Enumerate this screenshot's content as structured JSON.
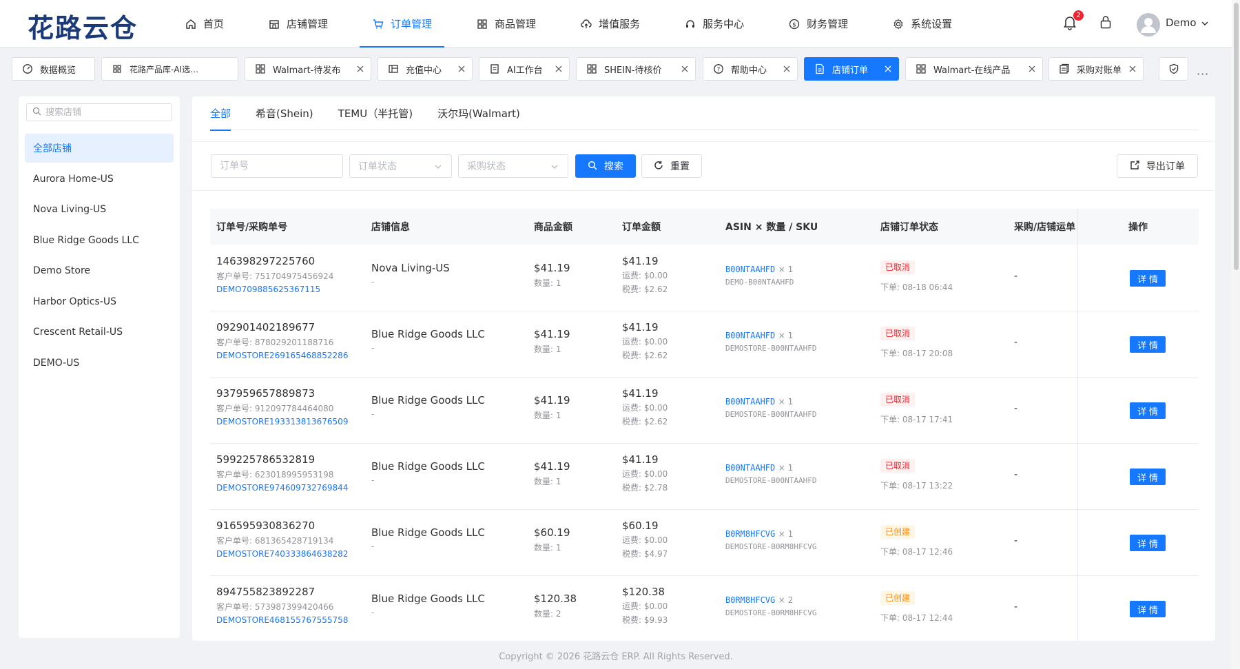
{
  "app": {
    "logo": "花路云仓"
  },
  "nav": [
    {
      "label": "首页",
      "icon": "home-icon"
    },
    {
      "label": "店铺管理",
      "icon": "store-icon"
    },
    {
      "label": "订单管理",
      "icon": "cart-icon",
      "active": true
    },
    {
      "label": "商品管理",
      "icon": "grid-icon"
    },
    {
      "label": "增值服务",
      "icon": "cloud-icon"
    },
    {
      "label": "服务中心",
      "icon": "headset-icon"
    },
    {
      "label": "财务管理",
      "icon": "dollar-icon"
    },
    {
      "label": "系统设置",
      "icon": "gear-icon"
    }
  ],
  "header": {
    "notification_count": "2",
    "username": "Demo"
  },
  "tabs": [
    {
      "label": "数据概览",
      "icon": "dashboard-icon",
      "closable": false
    },
    {
      "label": "花路产品库-AI选…",
      "icon": "grid-icon",
      "closable": false
    },
    {
      "label": "Walmart-待发布",
      "icon": "grid-icon",
      "closable": true
    },
    {
      "label": "充值中心",
      "icon": "wallet-icon",
      "closable": true
    },
    {
      "label": "AI工作台",
      "icon": "robot-icon",
      "closable": true
    },
    {
      "label": "SHEIN-待核价",
      "icon": "grid-icon",
      "closable": true
    },
    {
      "label": "帮助中心",
      "icon": "help-icon",
      "closable": true
    },
    {
      "label": "店铺订单",
      "icon": "document-icon",
      "closable": true,
      "active": true
    },
    {
      "label": "Walmart-在线产品",
      "icon": "grid-icon",
      "closable": true
    },
    {
      "label": "采购对账单",
      "icon": "ledger-icon",
      "closable": true
    },
    {
      "label": "",
      "icon": "shield-icon",
      "closable": false
    }
  ],
  "tab_more": "···",
  "stores": {
    "search_placeholder": "搜索店铺",
    "items": [
      "全部店铺",
      "Aurora Home-US",
      "Nova Living-US",
      "Blue Ridge Goods LLC",
      "Demo Store",
      "Harbor Optics-US",
      "Crescent Retail-US",
      "DEMO-US"
    ]
  },
  "platform_tabs": [
    "全部",
    "希音(Shein)",
    "TEMU（半托管)",
    "沃尔玛(Walmart)"
  ],
  "filters": {
    "order_no_placeholder": "订单号",
    "order_status_placeholder": "订单状态",
    "purchase_status_placeholder": "采购状态",
    "search_label": "搜索",
    "reset_label": "重置",
    "export_label": "导出订单"
  },
  "table": {
    "headers": [
      "订单号/采购单号",
      "店铺信息",
      "商品金额",
      "订单金额",
      "ASIN × 数量 / SKU",
      "店铺订单状态",
      "采购/店铺运单",
      "操作"
    ],
    "detail_label": "详情",
    "rows": [
      {
        "order_no": "146398297225760",
        "customer_no": "客户单号: 751704975456924",
        "po": "DEMO709885625367115",
        "store": "Nova Living-US",
        "store_sub": "-",
        "goods_amount": "$41.19",
        "qty": "数量: 1",
        "order_amount": "$41.19",
        "freight": "运费: $0.00",
        "tax": "税费: $2.62",
        "asin": "B00NTAAHFD",
        "asin_qty": "× 1",
        "sku": "DEMO-B00NTAAHFD",
        "status": "已取消",
        "status_type": "cancel",
        "order_time": "下单: 08-18 06:44",
        "ship": "-"
      },
      {
        "order_no": "092901402189677",
        "customer_no": "客户单号: 878029201188716",
        "po": "DEMOSTORE269165468852286",
        "store": "Blue Ridge Goods LLC",
        "store_sub": "-",
        "goods_amount": "$41.19",
        "qty": "数量: 1",
        "order_amount": "$41.19",
        "freight": "运费: $0.00",
        "tax": "税费: $2.62",
        "asin": "B00NTAAHFD",
        "asin_qty": "× 1",
        "sku": "DEMOSTORE-B00NTAAHFD",
        "status": "已取消",
        "status_type": "cancel",
        "order_time": "下单: 08-17 20:08",
        "ship": "-"
      },
      {
        "order_no": "937959657889873",
        "customer_no": "客户单号: 912097784464080",
        "po": "DEMOSTORE193313813676509",
        "store": "Blue Ridge Goods LLC",
        "store_sub": "-",
        "goods_amount": "$41.19",
        "qty": "数量: 1",
        "order_amount": "$41.19",
        "freight": "运费: $0.00",
        "tax": "税费: $2.62",
        "asin": "B00NTAAHFD",
        "asin_qty": "× 1",
        "sku": "DEMOSTORE-B00NTAAHFD",
        "status": "已取消",
        "status_type": "cancel",
        "order_time": "下单: 08-17 17:41",
        "ship": "-"
      },
      {
        "order_no": "599225786532819",
        "customer_no": "客户单号: 623018995953198",
        "po": "DEMOSTORE974609732769844",
        "store": "Blue Ridge Goods LLC",
        "store_sub": "-",
        "goods_amount": "$41.19",
        "qty": "数量: 1",
        "order_amount": "$41.19",
        "freight": "运费: $0.00",
        "tax": "税费: $2.78",
        "asin": "B00NTAAHFD",
        "asin_qty": "× 1",
        "sku": "DEMOSTORE-B00NTAAHFD",
        "status": "已取消",
        "status_type": "cancel",
        "order_time": "下单: 08-17 13:22",
        "ship": "-"
      },
      {
        "order_no": "916595930836270",
        "customer_no": "客户单号: 681365428719134",
        "po": "DEMOSTORE740333864638282",
        "store": "Blue Ridge Goods LLC",
        "store_sub": "-",
        "goods_amount": "$60.19",
        "qty": "数量: 1",
        "order_amount": "$60.19",
        "freight": "运费: $0.00",
        "tax": "税费: $4.97",
        "asin": "B0RM8HFCVG",
        "asin_qty": "× 1",
        "sku": "DEMOSTORE-B0RM8HFCVG",
        "status": "已创建",
        "status_type": "created",
        "order_time": "下单: 08-17 12:46",
        "ship": "-"
      },
      {
        "order_no": "894755823892287",
        "customer_no": "客户单号: 573987399420466",
        "po": "DEMOSTORE468155767555758",
        "store": "Blue Ridge Goods LLC",
        "store_sub": "-",
        "goods_amount": "$120.38",
        "qty": "数量: 2",
        "order_amount": "$120.38",
        "freight": "运费: $0.00",
        "tax": "税费: $9.93",
        "asin": "B0RM8HFCVG",
        "asin_qty": "× 2",
        "sku": "DEMOSTORE-B0RM8HFCVG",
        "status": "已创建",
        "status_type": "created",
        "order_time": "下单: 08-17 12:44",
        "ship": "-"
      }
    ]
  },
  "footer": "Copyright © 2026 花路云仓 ERP. All Rights Reserved.",
  "colors": {
    "primary": "#1677ff",
    "logo": "#1a3a7a",
    "cancel": "#f5222d",
    "created": "#fa8c16"
  }
}
